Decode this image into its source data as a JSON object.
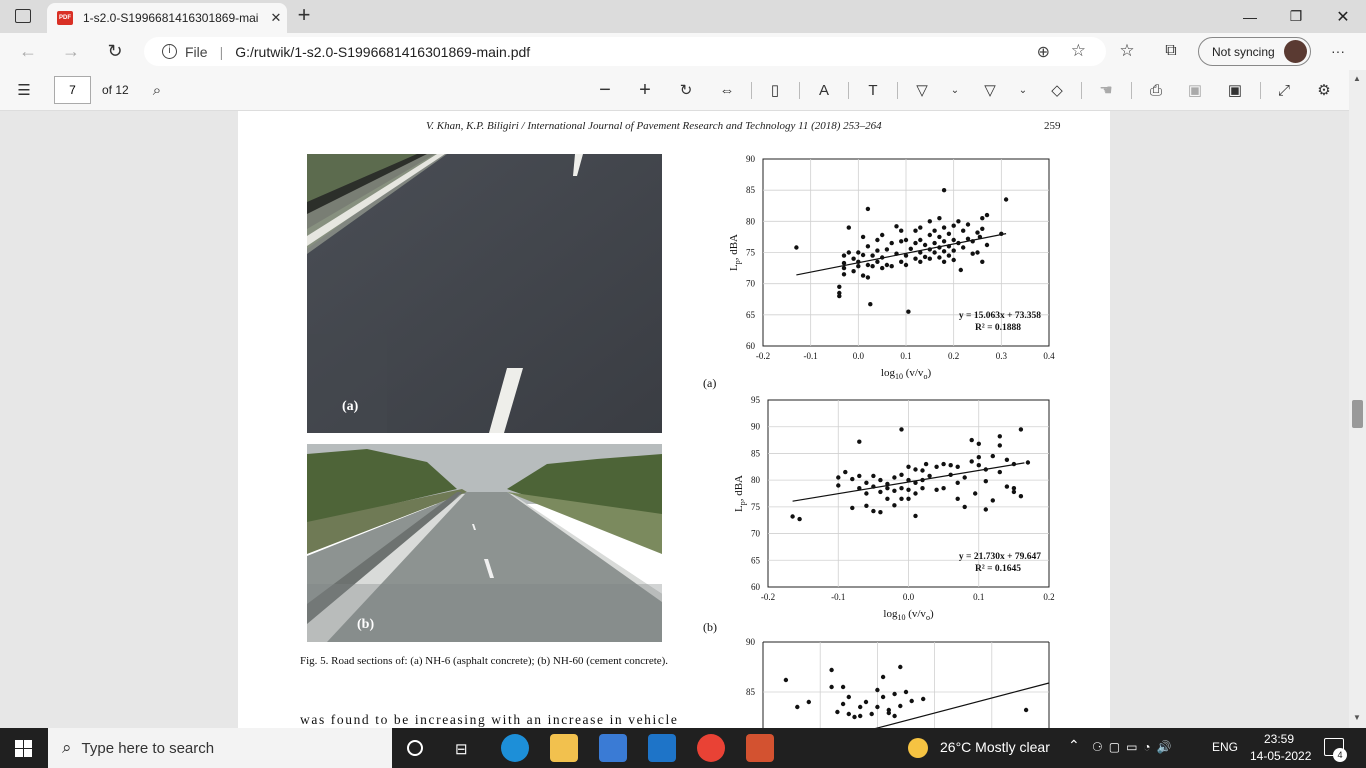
{
  "browser": {
    "tab_title": "1-s2.0-S1996681416301869-mai",
    "tab_close": "✕",
    "new_tab": "+",
    "url_scheme": "File",
    "url": "G:/rutwik/1-s2.0-S1996681416301869-main.pdf",
    "sync_label": "Not syncing",
    "menu": "···"
  },
  "pdf_toolbar": {
    "page_current": "7",
    "page_total": "of 12"
  },
  "page": {
    "header": "V.  Khan,  K.P.  Biligiri / International  Journal  of  Pavement  Research  and  Technology  11  (2018)  253–264",
    "page_number": "259",
    "photo_a_label": "(a)",
    "photo_b_label": "(b)",
    "caption": "Fig. 5.  Road sections of: (a) NH-6 (asphalt concrete); (b) NH-60 (cement concrete).",
    "body_text": "was found to be increasing with an increase in vehicle",
    "chart_a_label": "(a)",
    "chart_b_label": "(b)"
  },
  "chart_data": [
    {
      "type": "scatter",
      "ylabel": "Lp, dBA",
      "xlabel": "log10 (v/vo)",
      "xlim": [
        -0.2,
        0.4
      ],
      "ylim": [
        60,
        90
      ],
      "xticks": [
        "-0.2",
        "-0.1",
        "0.0",
        "0.1",
        "0.2",
        "0.3",
        "0.4"
      ],
      "yticks": [
        "60",
        "65",
        "70",
        "75",
        "80",
        "85",
        "90"
      ],
      "equation": "y = 15.063x + 73.358",
      "r2": "R² = 0.1888",
      "trend": {
        "slope": 15.063,
        "intercept": 73.358,
        "x_range": [
          -0.13,
          0.31
        ]
      },
      "points": [
        [
          -0.13,
          75.8
        ],
        [
          -0.04,
          69.5
        ],
        [
          -0.04,
          68.5
        ],
        [
          -0.04,
          68
        ],
        [
          -0.03,
          74.5
        ],
        [
          -0.03,
          73.3
        ],
        [
          -0.03,
          72.5
        ],
        [
          -0.03,
          71.5
        ],
        [
          -0.02,
          79
        ],
        [
          -0.02,
          75
        ],
        [
          -0.01,
          74
        ],
        [
          -0.01,
          72
        ],
        [
          0.0,
          75
        ],
        [
          0.0,
          73.5
        ],
        [
          0.0,
          72.8
        ],
        [
          0.01,
          77.5
        ],
        [
          0.01,
          74.6
        ],
        [
          0.01,
          71.3
        ],
        [
          0.02,
          82
        ],
        [
          0.02,
          76
        ],
        [
          0.02,
          73
        ],
        [
          0.02,
          71
        ],
        [
          0.025,
          66.7
        ],
        [
          0.03,
          74.5
        ],
        [
          0.03,
          72.8
        ],
        [
          0.04,
          77
        ],
        [
          0.04,
          75.3
        ],
        [
          0.04,
          73.5
        ],
        [
          0.05,
          77.8
        ],
        [
          0.05,
          74.2
        ],
        [
          0.05,
          72.5
        ],
        [
          0.06,
          75.5
        ],
        [
          0.06,
          73
        ],
        [
          0.07,
          76.5
        ],
        [
          0.07,
          72.8
        ],
        [
          0.08,
          79.2
        ],
        [
          0.08,
          74.8
        ],
        [
          0.09,
          78.5
        ],
        [
          0.09,
          76.8
        ],
        [
          0.09,
          73.5
        ],
        [
          0.1,
          77
        ],
        [
          0.1,
          74.5
        ],
        [
          0.1,
          73
        ],
        [
          0.105,
          65.5
        ],
        [
          0.11,
          75.6
        ],
        [
          0.12,
          78.5
        ],
        [
          0.12,
          76.5
        ],
        [
          0.12,
          74
        ],
        [
          0.13,
          79
        ],
        [
          0.13,
          77
        ],
        [
          0.13,
          75
        ],
        [
          0.13,
          73.5
        ],
        [
          0.14,
          76.2
        ],
        [
          0.14,
          74.3
        ],
        [
          0.15,
          80
        ],
        [
          0.15,
          77.8
        ],
        [
          0.15,
          75.5
        ],
        [
          0.15,
          74
        ],
        [
          0.16,
          78.5
        ],
        [
          0.16,
          76.5
        ],
        [
          0.16,
          75
        ],
        [
          0.17,
          80.5
        ],
        [
          0.17,
          77.5
        ],
        [
          0.17,
          75.8
        ],
        [
          0.17,
          74.2
        ],
        [
          0.18,
          85
        ],
        [
          0.18,
          79
        ],
        [
          0.18,
          76.8
        ],
        [
          0.18,
          75.2
        ],
        [
          0.18,
          73.5
        ],
        [
          0.19,
          78
        ],
        [
          0.19,
          76
        ],
        [
          0.19,
          74.5
        ],
        [
          0.2,
          79.3
        ],
        [
          0.2,
          77
        ],
        [
          0.2,
          75.3
        ],
        [
          0.2,
          73.8
        ],
        [
          0.21,
          80
        ],
        [
          0.21,
          76.5
        ],
        [
          0.22,
          78.5
        ],
        [
          0.22,
          75.8
        ],
        [
          0.23,
          79.5
        ],
        [
          0.23,
          77.2
        ],
        [
          0.24,
          76.8
        ],
        [
          0.24,
          74.8
        ],
        [
          0.25,
          78.2
        ],
        [
          0.25,
          75
        ],
        [
          0.26,
          80.5
        ],
        [
          0.26,
          78.8
        ],
        [
          0.26,
          73.5
        ],
        [
          0.27,
          81
        ],
        [
          0.3,
          78
        ],
        [
          0.31,
          83.5
        ],
        [
          0.27,
          76.2
        ],
        [
          0.255,
          77.5
        ],
        [
          0.215,
          72.2
        ]
      ]
    },
    {
      "type": "scatter",
      "ylabel": "Lp, dBA",
      "xlabel": "log10 (v/vo)",
      "xlim": [
        -0.2,
        0.2
      ],
      "ylim": [
        60,
        95
      ],
      "xticks": [
        "-0.2",
        "-0.1",
        "0.0",
        "0.1",
        "0.2"
      ],
      "yticks": [
        "60",
        "65",
        "70",
        "75",
        "80",
        "85",
        "90",
        "95"
      ],
      "equation": "y = 21.730x + 79.647",
      "r2": "R² = 0.1645",
      "trend": {
        "slope": 21.73,
        "intercept": 79.647,
        "x_range": [
          -0.165,
          0.165
        ]
      },
      "points": [
        [
          -0.165,
          73.2
        ],
        [
          -0.155,
          72.7
        ],
        [
          -0.1,
          80.5
        ],
        [
          -0.1,
          79
        ],
        [
          -0.09,
          81.5
        ],
        [
          -0.08,
          80.2
        ],
        [
          -0.08,
          74.8
        ],
        [
          -0.07,
          87.2
        ],
        [
          -0.07,
          80.8
        ],
        [
          -0.07,
          78.5
        ],
        [
          -0.06,
          79.5
        ],
        [
          -0.06,
          77.5
        ],
        [
          -0.06,
          75.2
        ],
        [
          -0.05,
          80.8
        ],
        [
          -0.05,
          78.8
        ],
        [
          -0.05,
          74.2
        ],
        [
          -0.04,
          80
        ],
        [
          -0.04,
          77.8
        ],
        [
          -0.04,
          74
        ],
        [
          -0.03,
          79.3
        ],
        [
          -0.03,
          76.5
        ],
        [
          -0.02,
          80.5
        ],
        [
          -0.02,
          78
        ],
        [
          -0.02,
          75.3
        ],
        [
          -0.01,
          89.5
        ],
        [
          -0.01,
          81
        ],
        [
          -0.01,
          78.5
        ],
        [
          -0.01,
          76.5
        ],
        [
          0.0,
          82.5
        ],
        [
          0.0,
          80
        ],
        [
          0.0,
          78.2
        ],
        [
          0.0,
          76.5
        ],
        [
          0.01,
          82
        ],
        [
          0.01,
          79.5
        ],
        [
          0.01,
          77.5
        ],
        [
          0.01,
          73.3
        ],
        [
          0.02,
          80
        ],
        [
          0.02,
          78.5
        ],
        [
          0.025,
          83
        ],
        [
          0.03,
          80.8
        ],
        [
          0.04,
          82.5
        ],
        [
          0.05,
          83
        ],
        [
          0.05,
          78.5
        ],
        [
          0.06,
          82.8
        ],
        [
          0.06,
          81
        ],
        [
          0.07,
          82.5
        ],
        [
          0.07,
          79.5
        ],
        [
          0.07,
          76.5
        ],
        [
          0.08,
          80.5
        ],
        [
          0.08,
          75
        ],
        [
          0.09,
          87.5
        ],
        [
          0.09,
          83.5
        ],
        [
          0.095,
          77.5
        ],
        [
          0.1,
          86.8
        ],
        [
          0.1,
          84.3
        ],
        [
          0.1,
          82.8
        ],
        [
          0.11,
          82
        ],
        [
          0.11,
          79.8
        ],
        [
          0.11,
          74.5
        ],
        [
          0.12,
          84.5
        ],
        [
          0.13,
          88.2
        ],
        [
          0.13,
          86.5
        ],
        [
          0.14,
          83.8
        ],
        [
          0.15,
          83
        ],
        [
          0.15,
          78.5
        ],
        [
          0.16,
          89.5
        ],
        [
          0.16,
          77
        ],
        [
          0.17,
          83.3
        ],
        [
          0.13,
          81.5
        ],
        [
          0.14,
          78.8
        ],
        [
          0.15,
          77.8
        ],
        [
          0.12,
          76.2
        ],
        [
          0.04,
          78.2
        ],
        [
          -0.03,
          78.5
        ],
        [
          0.02,
          81.8
        ]
      ]
    },
    {
      "type": "scatter",
      "ylim": [
        80,
        90
      ],
      "yticks": [
        "85",
        "90"
      ],
      "xlim": [
        -0.2,
        0.3
      ],
      "trend": {
        "slope": 15,
        "intercept": 81.4,
        "x_range": [
          -0.05,
          0.3
        ]
      },
      "points": [
        [
          -0.16,
          86.2
        ],
        [
          -0.14,
          83.5
        ],
        [
          -0.12,
          84
        ],
        [
          -0.08,
          87.2
        ],
        [
          -0.08,
          85.5
        ],
        [
          -0.06,
          85.5
        ],
        [
          -0.06,
          83.8
        ],
        [
          -0.05,
          84.5
        ],
        [
          -0.04,
          82.5
        ],
        [
          -0.03,
          83.5
        ],
        [
          -0.02,
          84
        ],
        [
          -0.01,
          82.8
        ],
        [
          0.0,
          85.2
        ],
        [
          0.0,
          83.5
        ],
        [
          0.01,
          86.5
        ],
        [
          0.01,
          84.5
        ],
        [
          0.02,
          83.2
        ],
        [
          0.03,
          84.8
        ],
        [
          0.04,
          87.5
        ],
        [
          0.04,
          83.6
        ],
        [
          0.05,
          85
        ],
        [
          0.06,
          84.1
        ],
        [
          0.08,
          84.3
        ],
        [
          0.26,
          83.2
        ],
        [
          -0.05,
          82.8
        ],
        [
          -0.07,
          83
        ],
        [
          -0.03,
          82.6
        ],
        [
          0.02,
          82.9
        ],
        [
          0.03,
          82.6
        ]
      ]
    }
  ],
  "taskbar": {
    "search_placeholder": "Type here to search",
    "weather": "26°C  Mostly clear",
    "lang": "ENG",
    "time": "23:59",
    "date": "14-05-2022",
    "notif_count": "4"
  },
  "colors": {
    "accent_pdf": "#d93025",
    "taskbar_bg": "#202020"
  }
}
